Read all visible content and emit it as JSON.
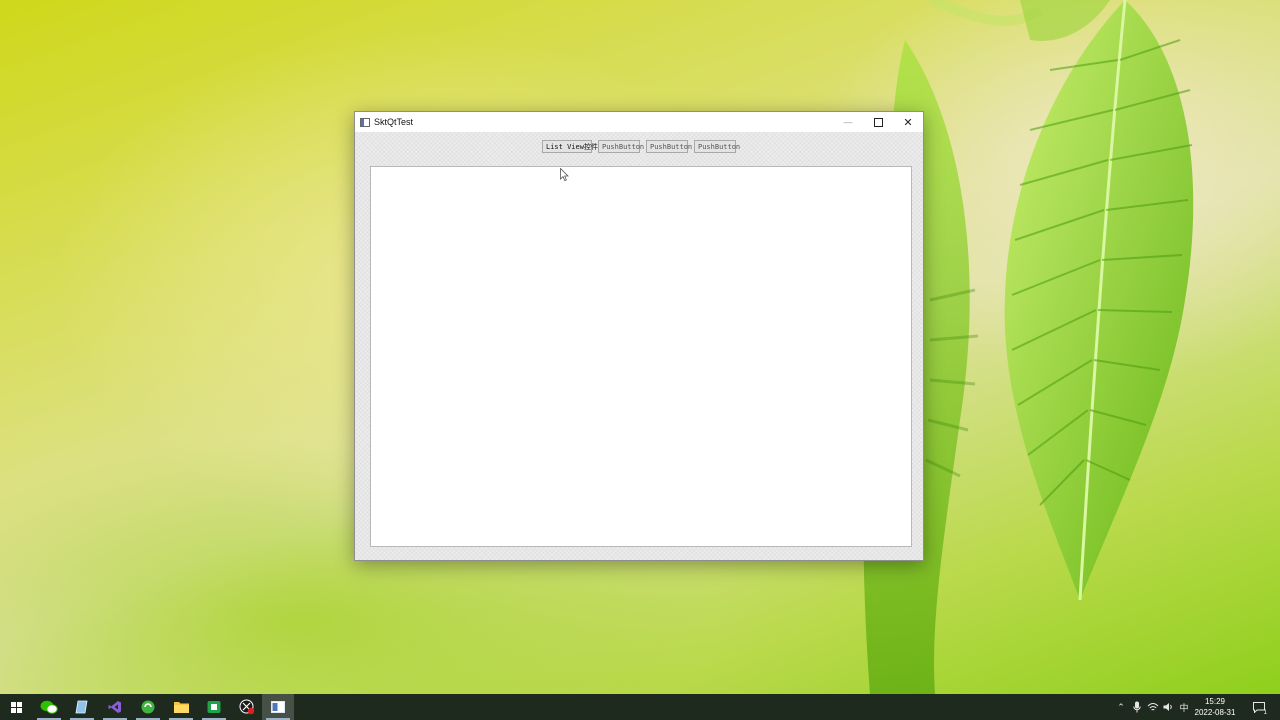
{
  "window": {
    "title": "SktQtTest",
    "buttons": [
      "List View控件",
      "PushButton",
      "PushButton",
      "PushButton"
    ]
  },
  "taskbar": {
    "apps": [
      "start-icon",
      "wechat-icon",
      "notepad-icon",
      "visual-studio-icon",
      "browser-icon",
      "file-explorer-icon",
      "terminal-icon",
      "record-icon",
      "sktqttest-app-icon"
    ],
    "ime": "中",
    "time": "15:29",
    "date": "2022-08-31",
    "notification_count": "1"
  },
  "colors": {
    "taskbar": "#1f2a1e",
    "window_bg": "#efefef",
    "accent_leaf": "#7cc520"
  }
}
